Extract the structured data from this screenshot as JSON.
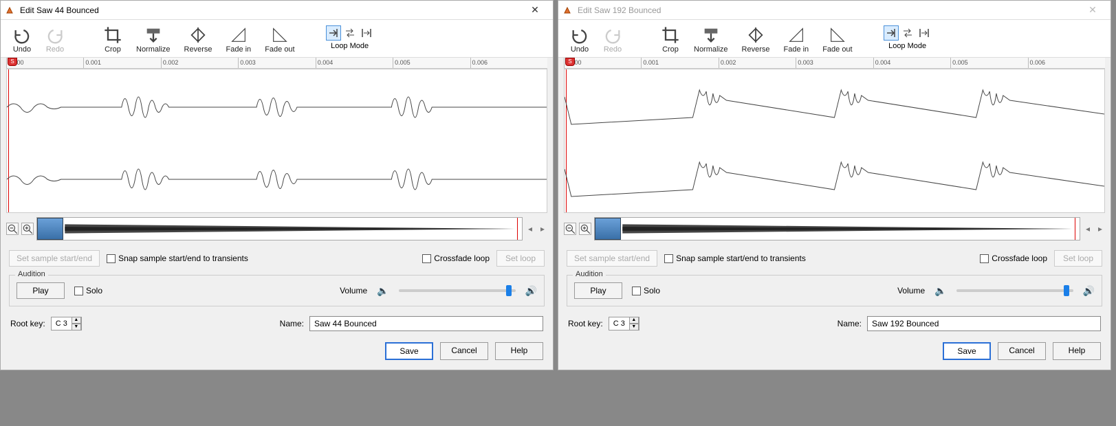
{
  "panes": [
    {
      "title": "Edit Saw 44 Bounced",
      "active": true,
      "name_value": "Saw 44 Bounced",
      "root_key": "C 3",
      "wave_style": "dense"
    },
    {
      "title": "Edit Saw 192 Bounced",
      "active": false,
      "name_value": "Saw 192 Bounced",
      "root_key": "C 3",
      "wave_style": "aliased"
    }
  ],
  "toolbar": {
    "undo": "Undo",
    "redo": "Redo",
    "crop": "Crop",
    "normalize": "Normalize",
    "reverse": "Reverse",
    "fade_in": "Fade in",
    "fade_out": "Fade out",
    "loop_mode": "Loop Mode"
  },
  "ruler_ticks": [
    "0.000",
    "0.001",
    "0.002",
    "0.003",
    "0.004",
    "0.005",
    "0.006"
  ],
  "marker": "S",
  "buttons": {
    "set_sample": "Set sample start/end",
    "snap_transients": "Snap sample start/end to transients",
    "crossfade": "Crossfade loop",
    "set_loop": "Set loop",
    "play": "Play",
    "solo": "Solo",
    "volume": "Volume",
    "root_key": "Root key:",
    "name": "Name:",
    "save": "Save",
    "cancel": "Cancel",
    "help": "Help",
    "audition": "Audition"
  }
}
